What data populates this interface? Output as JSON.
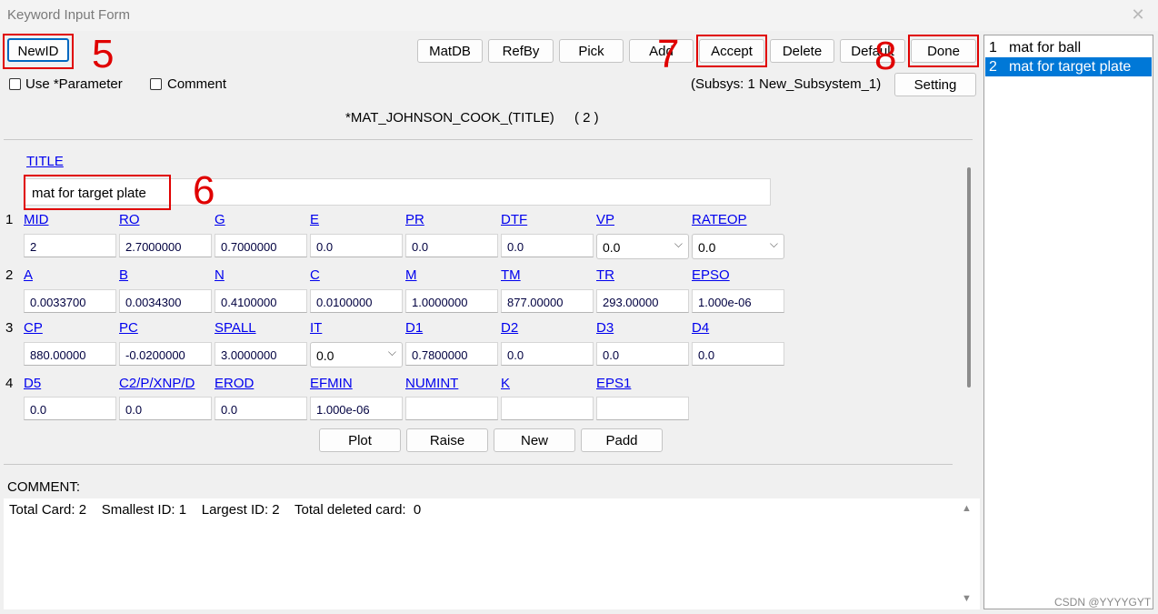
{
  "window": {
    "title": "Keyword Input Form",
    "close_icon": "close-icon"
  },
  "toolbar": {
    "newid": "NewID",
    "matdb": "MatDB",
    "refby": "RefBy",
    "pick": "Pick",
    "add": "Add",
    "accept": "Accept",
    "delete": "Delete",
    "default": "Default",
    "done": "Done",
    "setting": "Setting"
  },
  "options": {
    "use_parameter": "Use *Parameter",
    "comment": "Comment",
    "subsys": "(Subsys: 1 New_Subsystem_1)"
  },
  "keyword": {
    "name": "*MAT_JOHNSON_COOK_(TITLE)",
    "count": "( 2 )"
  },
  "title_field": {
    "label": "TITLE",
    "value": "mat for target plate"
  },
  "cards": [
    {
      "num": "1",
      "fields": [
        {
          "label": "MID",
          "value": "2"
        },
        {
          "label": "RO",
          "value": "2.7000000"
        },
        {
          "label": "G",
          "value": "0.7000000"
        },
        {
          "label": "E",
          "value": "0.0"
        },
        {
          "label": "PR",
          "value": "0.0"
        },
        {
          "label": "DTF",
          "value": "0.0"
        },
        {
          "label": "VP",
          "value": "0.0"
        },
        {
          "label": "RATEOP",
          "value": "0.0"
        }
      ]
    },
    {
      "num": "2",
      "fields": [
        {
          "label": "A",
          "value": "0.0033700"
        },
        {
          "label": "B",
          "value": "0.0034300"
        },
        {
          "label": "N",
          "value": "0.4100000"
        },
        {
          "label": "C",
          "value": "0.0100000"
        },
        {
          "label": "M",
          "value": "1.0000000"
        },
        {
          "label": "TM",
          "value": "877.00000"
        },
        {
          "label": "TR",
          "value": "293.00000"
        },
        {
          "label": "EPSO",
          "value": "1.000e-06"
        }
      ]
    },
    {
      "num": "3",
      "fields": [
        {
          "label": "CP",
          "value": "880.00000"
        },
        {
          "label": "PC",
          "value": "-0.0200000"
        },
        {
          "label": "SPALL",
          "value": "3.0000000"
        },
        {
          "label": "IT",
          "value": "0.0"
        },
        {
          "label": "D1",
          "value": "0.7800000"
        },
        {
          "label": "D2",
          "value": "0.0"
        },
        {
          "label": "D3",
          "value": "0.0"
        },
        {
          "label": "D4",
          "value": "0.0"
        }
      ]
    },
    {
      "num": "4",
      "fields": [
        {
          "label": "D5",
          "value": "0.0"
        },
        {
          "label": "C2/P/XNP/D",
          "value": "0.0"
        },
        {
          "label": "EROD",
          "value": "0.0"
        },
        {
          "label": "EFMIN",
          "value": "1.000e-06"
        },
        {
          "label": "NUMINT",
          "value": ""
        },
        {
          "label": "K",
          "value": ""
        },
        {
          "label": "EPS1",
          "value": ""
        }
      ]
    }
  ],
  "card_buttons": {
    "plot": "Plot",
    "raise": "Raise",
    "new": "New",
    "padd": "Padd"
  },
  "comment": {
    "label": "COMMENT:",
    "text": "Total Card: 2    Smallest ID: 1    Largest ID: 2    Total deleted card:  0"
  },
  "list": [
    {
      "num": "1",
      "name": "mat for ball",
      "selected": false
    },
    {
      "num": "2",
      "name": "mat for target plate",
      "selected": true
    }
  ],
  "annotations": {
    "n5": "5",
    "n6": "6",
    "n7": "7",
    "n8": "8",
    "color": "#e00000"
  },
  "watermark": "CSDN @YYYYGYT"
}
